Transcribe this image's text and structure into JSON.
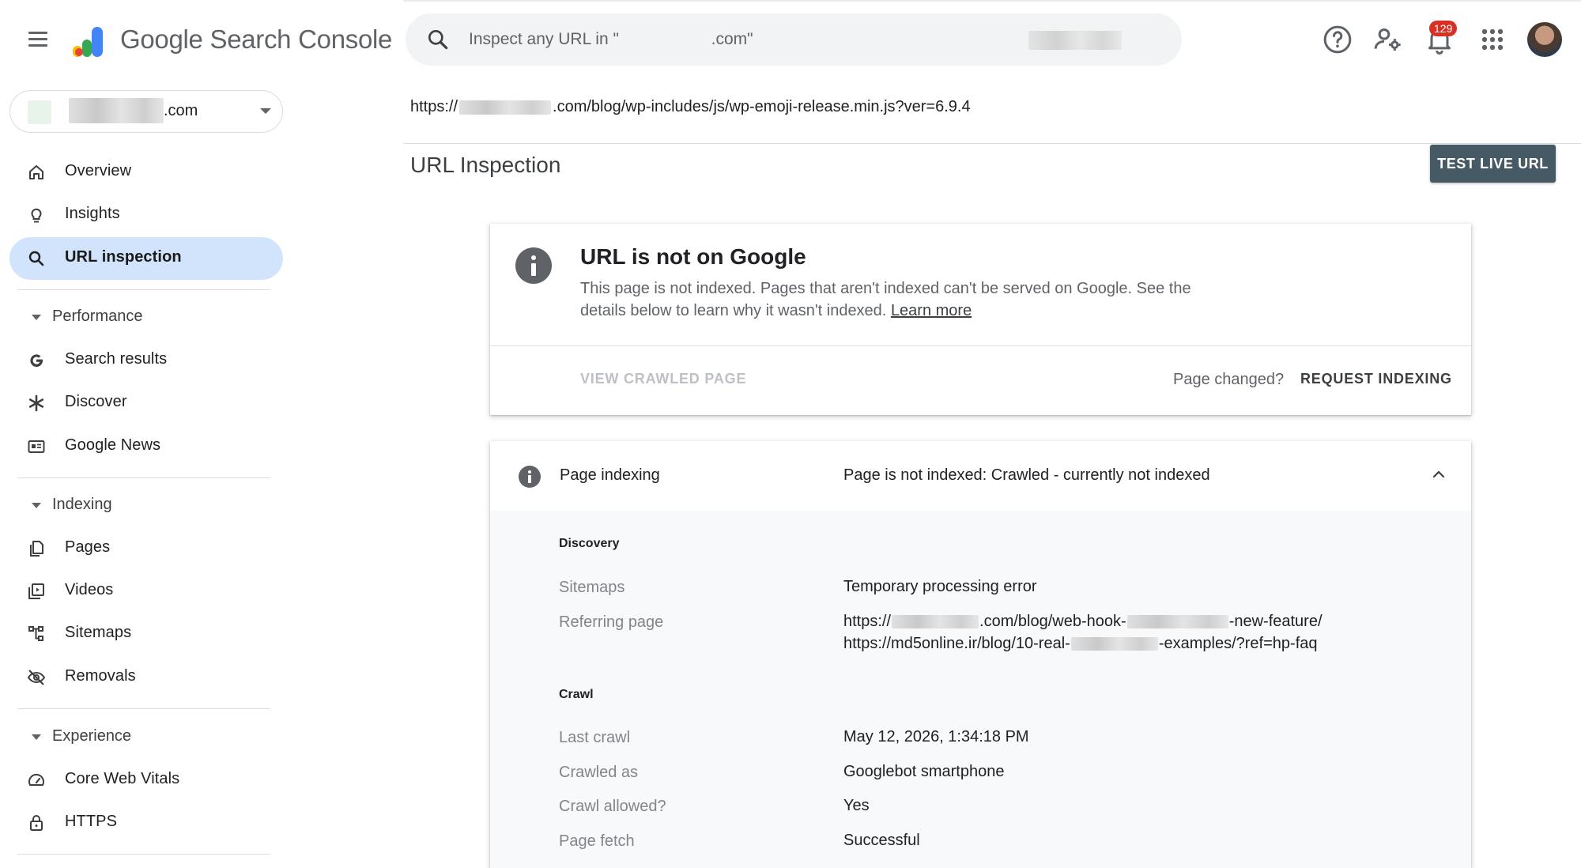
{
  "header": {
    "brand": "Google Search Console",
    "search_placeholder": "Inspect any URL in \"                    .com\"",
    "notification_count": "129"
  },
  "property": {
    "label": ".com"
  },
  "sidebar": {
    "items_top": [
      {
        "label": "Overview",
        "icon": "home-icon"
      },
      {
        "label": "Insights",
        "icon": "lightbulb-icon"
      },
      {
        "label": "URL inspection",
        "icon": "search-icon",
        "active": true
      }
    ],
    "performance": {
      "title": "Performance",
      "items": [
        {
          "label": "Search results",
          "icon": "google-g-icon"
        },
        {
          "label": "Discover",
          "icon": "asterisk-icon"
        },
        {
          "label": "Google News",
          "icon": "news-icon"
        }
      ]
    },
    "indexing": {
      "title": "Indexing",
      "items": [
        {
          "label": "Pages",
          "icon": "pages-icon"
        },
        {
          "label": "Videos",
          "icon": "video-icon"
        },
        {
          "label": "Sitemaps",
          "icon": "sitemap-icon"
        },
        {
          "label": "Removals",
          "icon": "eye-off-icon"
        }
      ]
    },
    "experience": {
      "title": "Experience",
      "items": [
        {
          "label": "Core Web Vitals",
          "icon": "gauge-icon"
        },
        {
          "label": "HTTPS",
          "icon": "lock-icon"
        }
      ]
    }
  },
  "main": {
    "url_prefix": "https://",
    "url_suffix": ".com/blog/wp-includes/js/wp-emoji-release.min.js?ver=6.9.4",
    "page_title": "URL Inspection",
    "test_live_url": "TEST LIVE URL",
    "status_card": {
      "title": "URL is not on Google",
      "description": "This page is not indexed. Pages that aren't indexed can't be served on Google. See the details below to learn why it wasn't indexed.",
      "learn_more": "Learn more",
      "view_crawled": "VIEW CRAWLED PAGE",
      "page_changed": "Page changed?",
      "request_indexing": "REQUEST INDEXING"
    },
    "indexing_card": {
      "label": "Page indexing",
      "value": "Page is not indexed: Crawled - currently not indexed",
      "discovery": {
        "title": "Discovery",
        "sitemaps_label": "Sitemaps",
        "sitemaps_value": "Temporary processing error",
        "referring_label": "Referring page",
        "ref1_prefix": "https://",
        "ref1_mid": ".com/blog/web-hook-",
        "ref1_suffix": "-new-feature/",
        "ref2_prefix": "https://md5online.ir/blog/10-real-",
        "ref2_suffix": "-examples/?ref=hp-faq"
      },
      "crawl": {
        "title": "Crawl",
        "rows": [
          {
            "label": "Last crawl",
            "value": "May 12, 2026, 1:34:18 PM"
          },
          {
            "label": "Crawled as",
            "value": "Googlebot smartphone"
          },
          {
            "label": "Crawl allowed?",
            "value": "Yes"
          },
          {
            "label": "Page fetch",
            "value": "Successful"
          }
        ]
      }
    }
  }
}
